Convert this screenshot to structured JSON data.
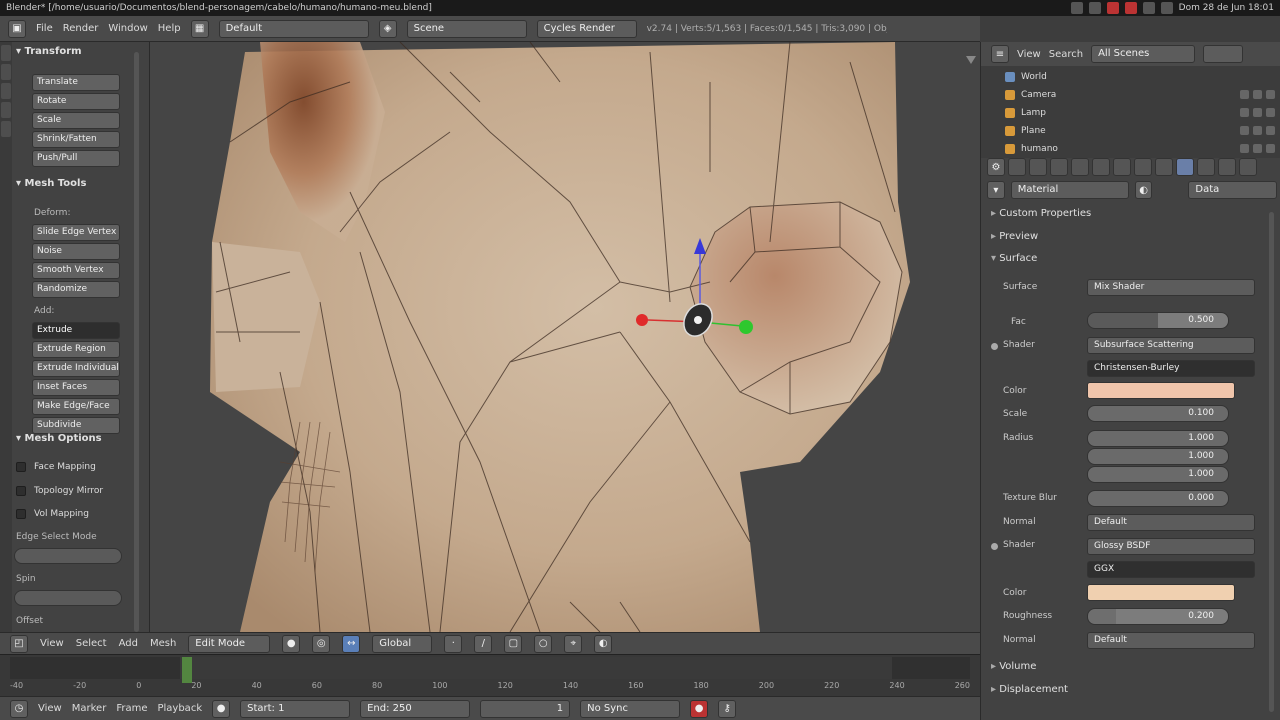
{
  "window": {
    "title": "Blender* [/home/usuario/Documentos/blend-personagem/cabelo/humano/humano-meu.blend]",
    "clock": "Dom 28 de Jun 18:01"
  },
  "menu": {
    "items": [
      "File",
      "Render",
      "Window",
      "Help"
    ],
    "layout": "Default",
    "scene": "Scene",
    "engine": "Cycles Render",
    "stats": "v2.74 | Verts:5/1,563 | Faces:0/1,545 | Tris:3,090 | Objects:1/4 | Lamps:0/1 | Mem:100.55M | humano"
  },
  "toolshelf": {
    "transform_header": "Transform",
    "transform_buttons": [
      "Translate",
      "Rotate",
      "Scale",
      "Shrink/Fatten",
      "Push/Pull"
    ],
    "mesh_tools_header": "Mesh Tools",
    "deform_label": "Deform:",
    "deform_buttons": [
      "Slide Edge Vertex",
      "Noise",
      "Smooth Vertex",
      "Randomize"
    ],
    "add_label": "Add:",
    "add_buttons": [
      "Extrude",
      "Extrude Region",
      "Extrude Individual",
      "Inset Faces",
      "Make Edge/Face",
      "Subdivide"
    ],
    "uv_header": "Mesh Options",
    "checkboxes": [
      "Face Mapping",
      "Topology Mirror",
      "Vol Mapping"
    ],
    "edge_select_label": "Edge Select Mode",
    "double_threshold_label": "Spin",
    "offset_label": "Offset"
  },
  "viewport_header": {
    "items": [
      "View",
      "Select",
      "Add",
      "Mesh"
    ],
    "mode": "Edit Mode",
    "pivot": "Global"
  },
  "timeline": {
    "ruler": [
      "-40",
      "-20",
      "0",
      "20",
      "40",
      "60",
      "80",
      "100",
      "120",
      "140",
      "160",
      "180",
      "200",
      "220",
      "240",
      "260"
    ],
    "header_items": [
      "View",
      "Marker",
      "Frame",
      "Playback"
    ],
    "start": "Start: 1",
    "end": "End: 250",
    "current": "1",
    "sync": "No Sync"
  },
  "outliner": {
    "view": "View",
    "search": "Search",
    "filter": "All Scenes",
    "rows": [
      "World",
      "Camera",
      "Lamp",
      "Plane",
      "humano"
    ]
  },
  "properties": {
    "material_slot": "Material",
    "data_select": "Data",
    "sections": {
      "custom_properties": "Custom Properties",
      "preview": "Preview",
      "surface": "Surface",
      "volume": "Volume",
      "displacement": "Displacement"
    },
    "surface_label": "Surface",
    "surface_value": "Mix Shader",
    "fac_label": "Fac",
    "fac_value": "0.500",
    "shader1_label": "Shader",
    "shader1_value": "Subsurface Scattering",
    "falloff_value": "Christensen-Burley",
    "color_label": "Color",
    "scale_label": "Scale",
    "scale_value": "0.100",
    "radius_label": "Radius",
    "radius_values": [
      "1.000",
      "1.000",
      "1.000"
    ],
    "sharpness_label": "Texture Blur",
    "sharpness_value": "0.000",
    "normal_label": "Normal",
    "normal_value": "Default",
    "shader2_label": "Shader",
    "shader2_value": "Glossy BSDF",
    "distribution_value": "GGX",
    "color2_label": "Color",
    "roughness_label": "Roughness",
    "roughness_value": "0.200",
    "normal2_label": "Normal",
    "normal2_value": "Default"
  },
  "colors": {
    "skin": "#c9b29a",
    "skin_shadow": "#a8815f",
    "subsurface_color": "#f0c5ab",
    "glossy_color": "#f0d0b0",
    "ui_bg": "#424242"
  }
}
